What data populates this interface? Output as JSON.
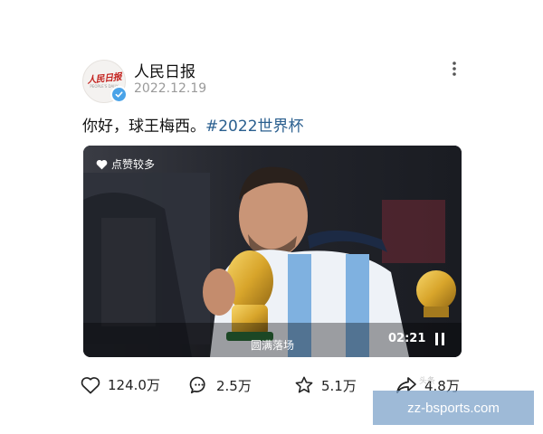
{
  "post": {
    "author": "人民日报",
    "avatar_logo_text": "人民日报",
    "avatar_sub_text": "PEOPLE'S DAILY",
    "date": "2022.12.19",
    "text": "你好，球王梅西。",
    "hashtag": "#2022世界杯"
  },
  "video": {
    "badge_label": "点赞较多",
    "caption": "圆满落场",
    "time": "02:21"
  },
  "actions": {
    "like_count": "124.0万",
    "comment_count": "2.5万",
    "favorite_count": "5.1万",
    "share_count": "4.8万"
  },
  "watermark": {
    "faint_label": "头条",
    "site": "zz-bsports.com"
  },
  "icons": {
    "avatar": "people-daily-logo",
    "verified": "verified-check-icon",
    "more": "more-vertical-icon",
    "badge": "heart-icon",
    "pause": "pause-icon",
    "like": "heart-outline-icon",
    "comment": "comment-bubble-icon",
    "favorite": "star-outline-icon",
    "share": "share-arrow-icon"
  },
  "colors": {
    "hashtag": "#2a5f8f",
    "verified": "#4aa3e8",
    "logo_red": "#c3221e",
    "site_badge": "#78a0c8"
  }
}
